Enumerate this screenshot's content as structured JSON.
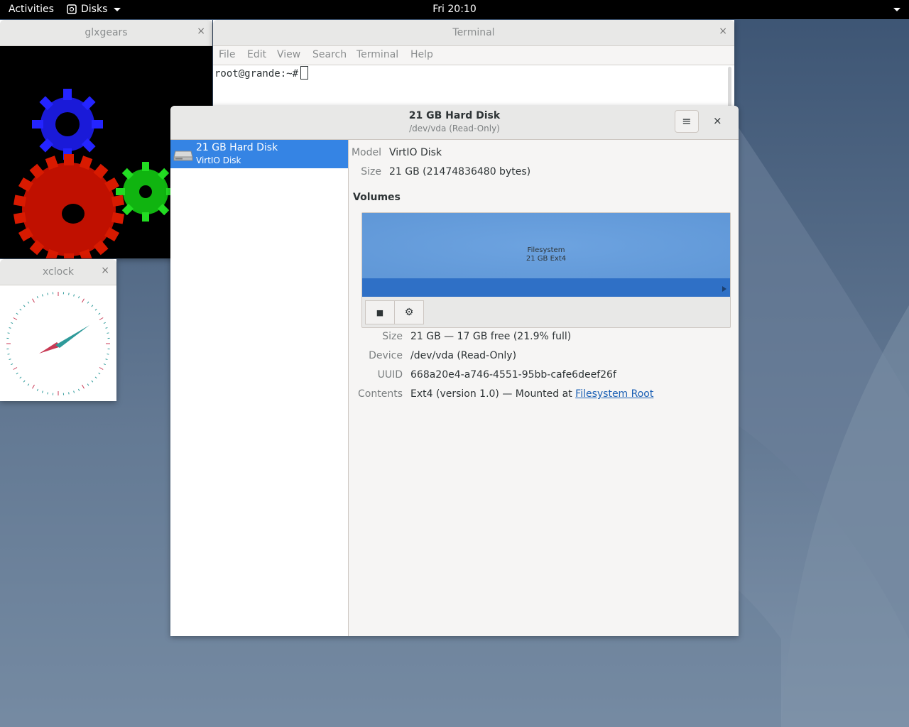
{
  "topbar": {
    "activities": "Activities",
    "app_name": "Disks",
    "clock": "Fri 20:10"
  },
  "glxgears": {
    "title": "glxgears",
    "close": "×"
  },
  "xclock": {
    "title": "xclock",
    "close": "×"
  },
  "terminal": {
    "title": "Terminal",
    "close": "×",
    "menu": [
      "File",
      "Edit",
      "View",
      "Search",
      "Terminal",
      "Help"
    ],
    "prompt": "root@grande:~#"
  },
  "disks": {
    "title": "21 GB Hard Disk",
    "subtitle": "/dev/vda (Read-Only)",
    "menu_icon": "≡",
    "close": "×",
    "sidebar": {
      "drive_name": "21 GB Hard Disk",
      "drive_model": "VirtIO Disk"
    },
    "details": {
      "model_label": "Model",
      "model_value": "VirtIO Disk",
      "size_label": "Size",
      "size_value": "21 GB (21474836480 bytes)"
    },
    "volumes": {
      "heading": "Volumes",
      "partition_line1": "Filesystem",
      "partition_line2": "21 GB Ext4",
      "stop_icon": "■",
      "settings_icon": "⚙",
      "size_label": "Size",
      "size_value": "21 GB — 17 GB free (21.9% full)",
      "device_label": "Device",
      "device_value": "/dev/vda (Read-Only)",
      "uuid_label": "UUID",
      "uuid_value": "668a20e4-a746-4551-95bb-cafe6deef26f",
      "contents_label": "Contents",
      "contents_value": "Ext4 (version 1.0) — Mounted at",
      "contents_link": "Filesystem Root"
    }
  }
}
